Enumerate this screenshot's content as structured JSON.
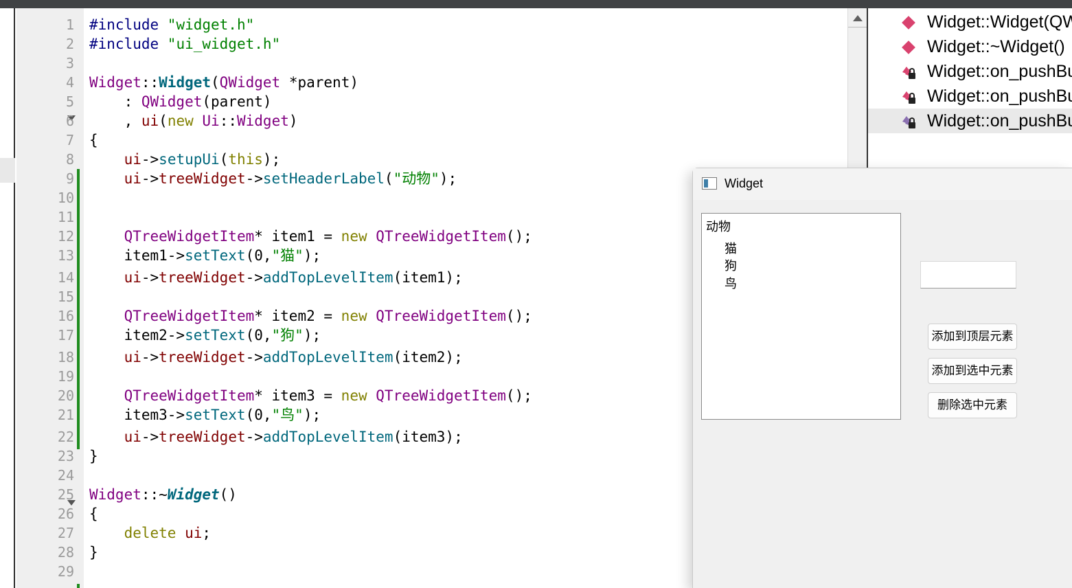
{
  "editor": {
    "lines": [
      {
        "n": "1",
        "segments": [
          {
            "c": "pp",
            "t": "#include "
          },
          {
            "c": "str",
            "t": "\"widget.h\""
          }
        ]
      },
      {
        "n": "2",
        "segments": [
          {
            "c": "pp",
            "t": "#include "
          },
          {
            "c": "str",
            "t": "\"ui_widget.h\""
          }
        ]
      },
      {
        "n": "3",
        "segments": []
      },
      {
        "n": "4",
        "segments": [
          {
            "c": "ty",
            "t": "Widget"
          },
          {
            "c": "",
            "t": "::"
          },
          {
            "c": "fnb",
            "t": "Widget"
          },
          {
            "c": "",
            "t": "("
          },
          {
            "c": "ty",
            "t": "QWidget"
          },
          {
            "c": "",
            "t": " *parent)"
          }
        ]
      },
      {
        "n": "5",
        "segments": [
          {
            "c": "",
            "t": "    : "
          },
          {
            "c": "ty",
            "t": "QWidget"
          },
          {
            "c": "",
            "t": "(parent)"
          }
        ]
      },
      {
        "n": "6",
        "segments": [
          {
            "c": "",
            "t": "    , "
          },
          {
            "c": "mem",
            "t": "ui"
          },
          {
            "c": "",
            "t": "("
          },
          {
            "c": "kw",
            "t": "new"
          },
          {
            "c": "",
            "t": " "
          },
          {
            "c": "ty",
            "t": "Ui"
          },
          {
            "c": "",
            "t": "::"
          },
          {
            "c": "ty",
            "t": "Widget"
          },
          {
            "c": "",
            "t": ")"
          }
        ]
      },
      {
        "n": "7",
        "segments": [
          {
            "c": "",
            "t": "{"
          }
        ]
      },
      {
        "n": "8",
        "segments": [
          {
            "c": "",
            "t": "    "
          },
          {
            "c": "mem",
            "t": "ui"
          },
          {
            "c": "",
            "t": "->"
          },
          {
            "c": "fn",
            "t": "setupUi"
          },
          {
            "c": "",
            "t": "("
          },
          {
            "c": "kw",
            "t": "this"
          },
          {
            "c": "",
            "t": ");"
          }
        ]
      },
      {
        "n": "9",
        "segments": [
          {
            "c": "",
            "t": "    "
          },
          {
            "c": "mem",
            "t": "ui"
          },
          {
            "c": "",
            "t": "->"
          },
          {
            "c": "mem",
            "t": "treeWidget"
          },
          {
            "c": "",
            "t": "->"
          },
          {
            "c": "fn",
            "t": "setHeaderLabel"
          },
          {
            "c": "",
            "t": "("
          },
          {
            "c": "str",
            "t": "\"动物\""
          },
          {
            "c": "",
            "t": ");"
          }
        ]
      },
      {
        "n": "10",
        "segments": []
      },
      {
        "n": "11",
        "segments": []
      },
      {
        "n": "12",
        "segments": [
          {
            "c": "",
            "t": "    "
          },
          {
            "c": "ty",
            "t": "QTreeWidgetItem"
          },
          {
            "c": "",
            "t": "* item1 = "
          },
          {
            "c": "kw",
            "t": "new"
          },
          {
            "c": "",
            "t": " "
          },
          {
            "c": "ty",
            "t": "QTreeWidgetItem"
          },
          {
            "c": "",
            "t": "();"
          }
        ]
      },
      {
        "n": "13",
        "segments": [
          {
            "c": "",
            "t": "    item1->"
          },
          {
            "c": "fn",
            "t": "setText"
          },
          {
            "c": "",
            "t": "(0,"
          },
          {
            "c": "str",
            "t": "\"猫\""
          },
          {
            "c": "",
            "t": ");"
          }
        ]
      },
      {
        "n": "14",
        "segments": [
          {
            "c": "",
            "t": "    "
          },
          {
            "c": "mem",
            "t": "ui"
          },
          {
            "c": "",
            "t": "->"
          },
          {
            "c": "mem",
            "t": "treeWidget"
          },
          {
            "c": "",
            "t": "->"
          },
          {
            "c": "fn",
            "t": "addTopLevelItem"
          },
          {
            "c": "",
            "t": "(item1);"
          }
        ]
      },
      {
        "n": "15",
        "segments": []
      },
      {
        "n": "16",
        "segments": [
          {
            "c": "",
            "t": "    "
          },
          {
            "c": "ty",
            "t": "QTreeWidgetItem"
          },
          {
            "c": "",
            "t": "* item2 = "
          },
          {
            "c": "kw",
            "t": "new"
          },
          {
            "c": "",
            "t": " "
          },
          {
            "c": "ty",
            "t": "QTreeWidgetItem"
          },
          {
            "c": "",
            "t": "();"
          }
        ]
      },
      {
        "n": "17",
        "segments": [
          {
            "c": "",
            "t": "    item2->"
          },
          {
            "c": "fn",
            "t": "setText"
          },
          {
            "c": "",
            "t": "(0,"
          },
          {
            "c": "str",
            "t": "\"狗\""
          },
          {
            "c": "",
            "t": ");"
          }
        ]
      },
      {
        "n": "18",
        "segments": [
          {
            "c": "",
            "t": "    "
          },
          {
            "c": "mem",
            "t": "ui"
          },
          {
            "c": "",
            "t": "->"
          },
          {
            "c": "mem",
            "t": "treeWidget"
          },
          {
            "c": "",
            "t": "->"
          },
          {
            "c": "fn",
            "t": "addTopLevelItem"
          },
          {
            "c": "",
            "t": "(item2);"
          }
        ]
      },
      {
        "n": "19",
        "segments": []
      },
      {
        "n": "20",
        "segments": [
          {
            "c": "",
            "t": "    "
          },
          {
            "c": "ty",
            "t": "QTreeWidgetItem"
          },
          {
            "c": "",
            "t": "* item3 = "
          },
          {
            "c": "kw",
            "t": "new"
          },
          {
            "c": "",
            "t": " "
          },
          {
            "c": "ty",
            "t": "QTreeWidgetItem"
          },
          {
            "c": "",
            "t": "();"
          }
        ]
      },
      {
        "n": "21",
        "segments": [
          {
            "c": "",
            "t": "    item3->"
          },
          {
            "c": "fn",
            "t": "setText"
          },
          {
            "c": "",
            "t": "(0,"
          },
          {
            "c": "str",
            "t": "\"鸟\""
          },
          {
            "c": "",
            "t": ");"
          }
        ]
      },
      {
        "n": "22",
        "segments": [
          {
            "c": "",
            "t": "    "
          },
          {
            "c": "mem",
            "t": "ui"
          },
          {
            "c": "",
            "t": "->"
          },
          {
            "c": "mem",
            "t": "treeWidget"
          },
          {
            "c": "",
            "t": "->"
          },
          {
            "c": "fn",
            "t": "addTopLevelItem"
          },
          {
            "c": "",
            "t": "(item3);"
          }
        ]
      },
      {
        "n": "23",
        "segments": [
          {
            "c": "",
            "t": "}"
          }
        ]
      },
      {
        "n": "24",
        "segments": []
      },
      {
        "n": "25",
        "segments": [
          {
            "c": "ty",
            "t": "Widget"
          },
          {
            "c": "",
            "t": "::~"
          },
          {
            "c": "fni",
            "t": "Widget"
          },
          {
            "c": "",
            "t": "()"
          }
        ]
      },
      {
        "n": "26",
        "segments": [
          {
            "c": "",
            "t": "{"
          }
        ]
      },
      {
        "n": "27",
        "segments": [
          {
            "c": "",
            "t": "    "
          },
          {
            "c": "kw",
            "t": "delete"
          },
          {
            "c": "",
            "t": " "
          },
          {
            "c": "mem",
            "t": "ui"
          },
          {
            "c": "",
            "t": ";"
          }
        ]
      },
      {
        "n": "28",
        "segments": [
          {
            "c": "",
            "t": "}"
          }
        ]
      },
      {
        "n": "29",
        "segments": []
      }
    ]
  },
  "outline": {
    "items": [
      {
        "label": "Widget::Widget(QW",
        "icon": "function-icon"
      },
      {
        "label": "Widget::~Widget()",
        "icon": "function-icon"
      },
      {
        "label": "Widget::on_pushBu",
        "icon": "private-slot-icon"
      },
      {
        "label": "Widget::on_pushBu",
        "icon": "private-slot-icon"
      },
      {
        "label": "Widget::on_pushBu",
        "icon": "private-slot-icon"
      }
    ]
  },
  "app_window": {
    "title": "Widget",
    "tree": {
      "header": "动物",
      "items": [
        "猫",
        "狗",
        "鸟"
      ]
    },
    "line_edit_value": "",
    "buttons": {
      "add_top": "添加到顶层元素",
      "add_selected": "添加到选中元素",
      "delete_selected": "删除选中元素"
    }
  },
  "colors": {
    "keyword": "#808000",
    "string": "#008000",
    "type": "#800080",
    "function": "#00677c",
    "member": "#800000",
    "preprocessor": "#000080",
    "change_marker": "#1e8c1e"
  }
}
